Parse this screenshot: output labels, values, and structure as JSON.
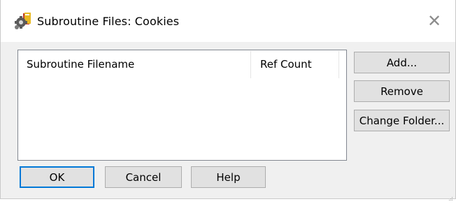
{
  "window": {
    "title": "Subroutine Files: Cookies",
    "close_glyph": "✕",
    "app_icon": "gear-book-icon"
  },
  "list": {
    "columns": [
      "Subroutine Filename",
      "Ref Count"
    ],
    "rows": []
  },
  "buttons": {
    "add": "Add...",
    "remove": "Remove",
    "change_folder": "Change Folder...",
    "ok": "OK",
    "cancel": "Cancel",
    "help": "Help"
  },
  "colors": {
    "dialog_bg": "#f0f0f0",
    "button_bg": "#e1e1e1",
    "default_button_border": "#0078d7"
  }
}
